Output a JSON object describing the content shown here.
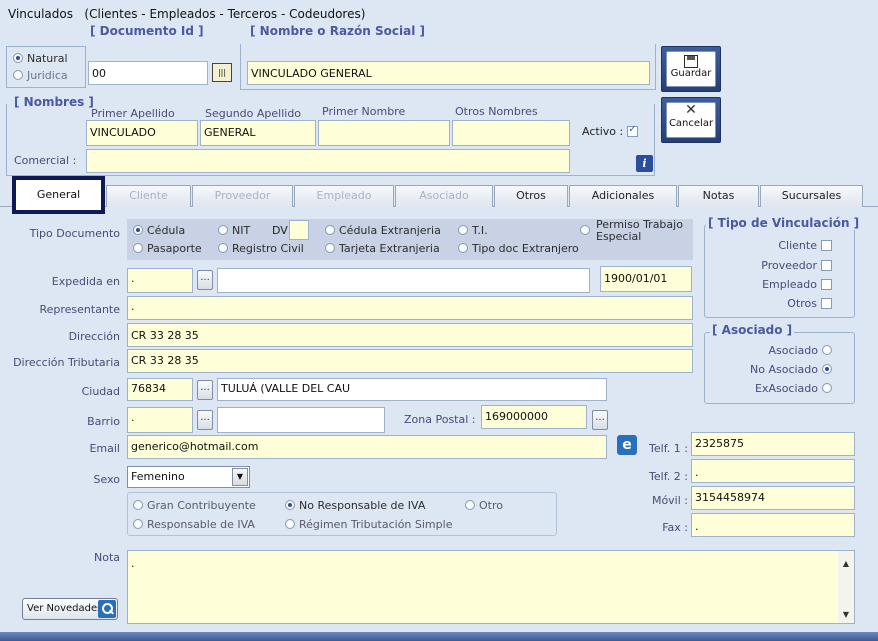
{
  "window": {
    "title": "Vinculados   (Clientes - Empleados - Terceros - Codeudores)"
  },
  "person_type": {
    "natural": "Natural",
    "juridica": "Juridica",
    "selected": "natural"
  },
  "doc_id": {
    "legend": "[ Documento Id ]",
    "value": "00"
  },
  "nombre_razon": {
    "legend": "[ Nombre o Razón Social ]",
    "value": "VINCULADO GENERAL"
  },
  "buttons": {
    "guardar": "Guardar",
    "cancelar": "Cancelar",
    "ver_novedades": "Ver Novedades"
  },
  "nombres": {
    "legend": "[ Nombres ]",
    "primer_apellido_label": "Primer Apellido",
    "segundo_apellido_label": "Segundo Apellido",
    "primer_nombre_label": "Primer Nombre",
    "otros_nombres_label": "Otros Nombres",
    "primer_apellido": "VINCULADO",
    "segundo_apellido": "GENERAL",
    "primer_nombre": "",
    "otros_nombres": ""
  },
  "activo": {
    "label": "Activo :",
    "checked": true
  },
  "comercial": {
    "label": "Comercial :",
    "value": ""
  },
  "tabs": [
    "General",
    "Cliente",
    "Proveedor",
    "Empleado",
    "Asociado",
    "Otros",
    "Adicionales",
    "Notas",
    "Sucursales"
  ],
  "tipo_documento": {
    "label": "Tipo Documento",
    "options": [
      "Cédula",
      "NIT",
      "Pasaporte",
      "Registro Civil",
      "Cédula Extranjeria",
      "T.I.",
      "Tarjeta Extranjeria",
      "Tipo doc Extranjero",
      "Permiso Trabajo Especial"
    ],
    "dv_label": "DV",
    "selected": "Cédula"
  },
  "expedida": {
    "label": "Expedida en",
    "code": ".",
    "name": "",
    "date": "1900/01/01"
  },
  "representante": {
    "label": "Representante",
    "value": "."
  },
  "direccion": {
    "label": "Dirección",
    "value": "CR 33  28  35"
  },
  "direccion_trib": {
    "label": "Dirección Tributaria",
    "value": "CR 33 28 35"
  },
  "ciudad": {
    "label": "Ciudad",
    "code": "76834",
    "name": "TULUÁ (VALLE DEL CAU"
  },
  "barrio": {
    "label": "Barrio",
    "code": ".",
    "name": ""
  },
  "zona_postal": {
    "label": "Zona Postal :",
    "value": "169000000"
  },
  "email": {
    "label": "Email",
    "value": "generico@hotmail.com"
  },
  "sexo": {
    "label": "Sexo",
    "value": "Femenino"
  },
  "regimen": {
    "options": [
      "Gran Contribuyente",
      "No Responsable de IVA",
      "Otro",
      "Responsable de IVA",
      "Régimen Tributación Simple"
    ],
    "selected": "No Responsable de IVA"
  },
  "telefonos": {
    "telf1_label": "Telf. 1 :",
    "telf1": "2325875",
    "telf2_label": "Telf. 2 :",
    "telf2": ".",
    "movil_label": "Móvil :",
    "movil": "3154458974",
    "fax_label": "Fax :",
    "fax": "."
  },
  "tipo_vinculacion": {
    "legend": "[ Tipo de Vinculación ]",
    "items": [
      "Cliente",
      "Proveedor",
      "Empleado",
      "Otros"
    ]
  },
  "asociado": {
    "legend": "[ Asociado ]",
    "items": [
      "Asociado",
      "No Asociado",
      "ExAsociado"
    ],
    "selected": "No Asociado"
  },
  "nota": {
    "label": "Nota",
    "value": "."
  },
  "colors": {
    "background": "#dde6f3",
    "field": "#fefed8",
    "label": "#4a4a78",
    "accent": "#2a4d9c"
  }
}
